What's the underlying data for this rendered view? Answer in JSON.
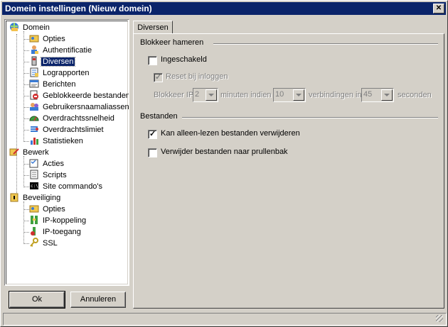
{
  "window": {
    "title": "Domein instellingen (Nieuw domein)",
    "close_glyph": "✕"
  },
  "tree": {
    "domein": "Domein",
    "domein_items": [
      "Opties",
      "Authentificatie",
      "Diversen",
      "Lograpporten",
      "Berichten",
      "Geblokkeerde bestanden",
      "Gebruikersnaamaliassen",
      "Overdrachtssnelheid",
      "Overdrachtslimiet",
      "Statistieken"
    ],
    "bewerk": "Bewerk",
    "bewerk_items": [
      "Acties",
      "Scripts",
      "Site commando's"
    ],
    "beveiliging": "Beveiliging",
    "beveiliging_items": [
      "Opties",
      "IP-koppeling",
      "IP-toegang",
      "SSL"
    ],
    "selected": "Diversen"
  },
  "buttons": {
    "ok": "Ok",
    "cancel": "Annuleren"
  },
  "tab": {
    "label": "Diversen"
  },
  "blokkeer": {
    "title": "Blokkeer hameren",
    "enabled_label": "Ingeschakeld",
    "enabled": false,
    "reset_label": "Reset bij inloggen",
    "reset": true,
    "ip_label": "Blokkeer IP",
    "ip_value": "2",
    "minutes_label": "minuten indien",
    "connections_value": "10",
    "connections_label": "verbindingen in",
    "seconds_value": "45",
    "seconds_label": "seconden"
  },
  "bestanden": {
    "title": "Bestanden",
    "readonly_label": "Kan alleen-lezen bestanden verwijderen",
    "readonly": true,
    "recycle_label": "Verwijder bestanden naar prullenbak",
    "recycle": false
  },
  "icons": {
    "domein": "domain-globe-icon",
    "opties": "options-folder-icon",
    "auth": "user-auth-icon",
    "diversen": "misc-icon",
    "log": "log-icon",
    "berichten": "messages-icon",
    "blocked": "blocked-files-icon",
    "alias": "alias-icon",
    "speed": "speed-gauge-icon",
    "limit": "limit-icon",
    "stats": "stats-icon",
    "bewerk": "edit-icon",
    "acties": "actions-icon",
    "scripts": "scripts-icon",
    "site": "terminal-icon",
    "beveiliging": "security-icon",
    "ipkop": "ip-binding-icon",
    "iptoeg": "ip-access-icon",
    "ssl": "key-icon"
  }
}
